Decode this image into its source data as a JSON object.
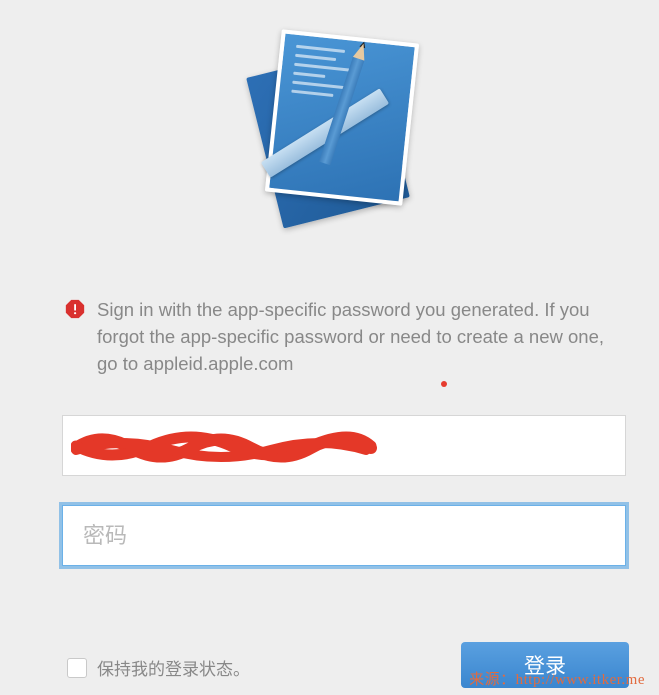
{
  "error": {
    "message": "Sign in with the app-specific password you generated. If you forgot the app-specific password or need to create a new one, go to appleid.apple.com"
  },
  "form": {
    "username_value": "",
    "password_placeholder": "密码",
    "password_value": ""
  },
  "footer": {
    "remember_label": "保持我的登录状态。",
    "login_label": "登录"
  },
  "watermark": "来源：http://www.itker.me"
}
